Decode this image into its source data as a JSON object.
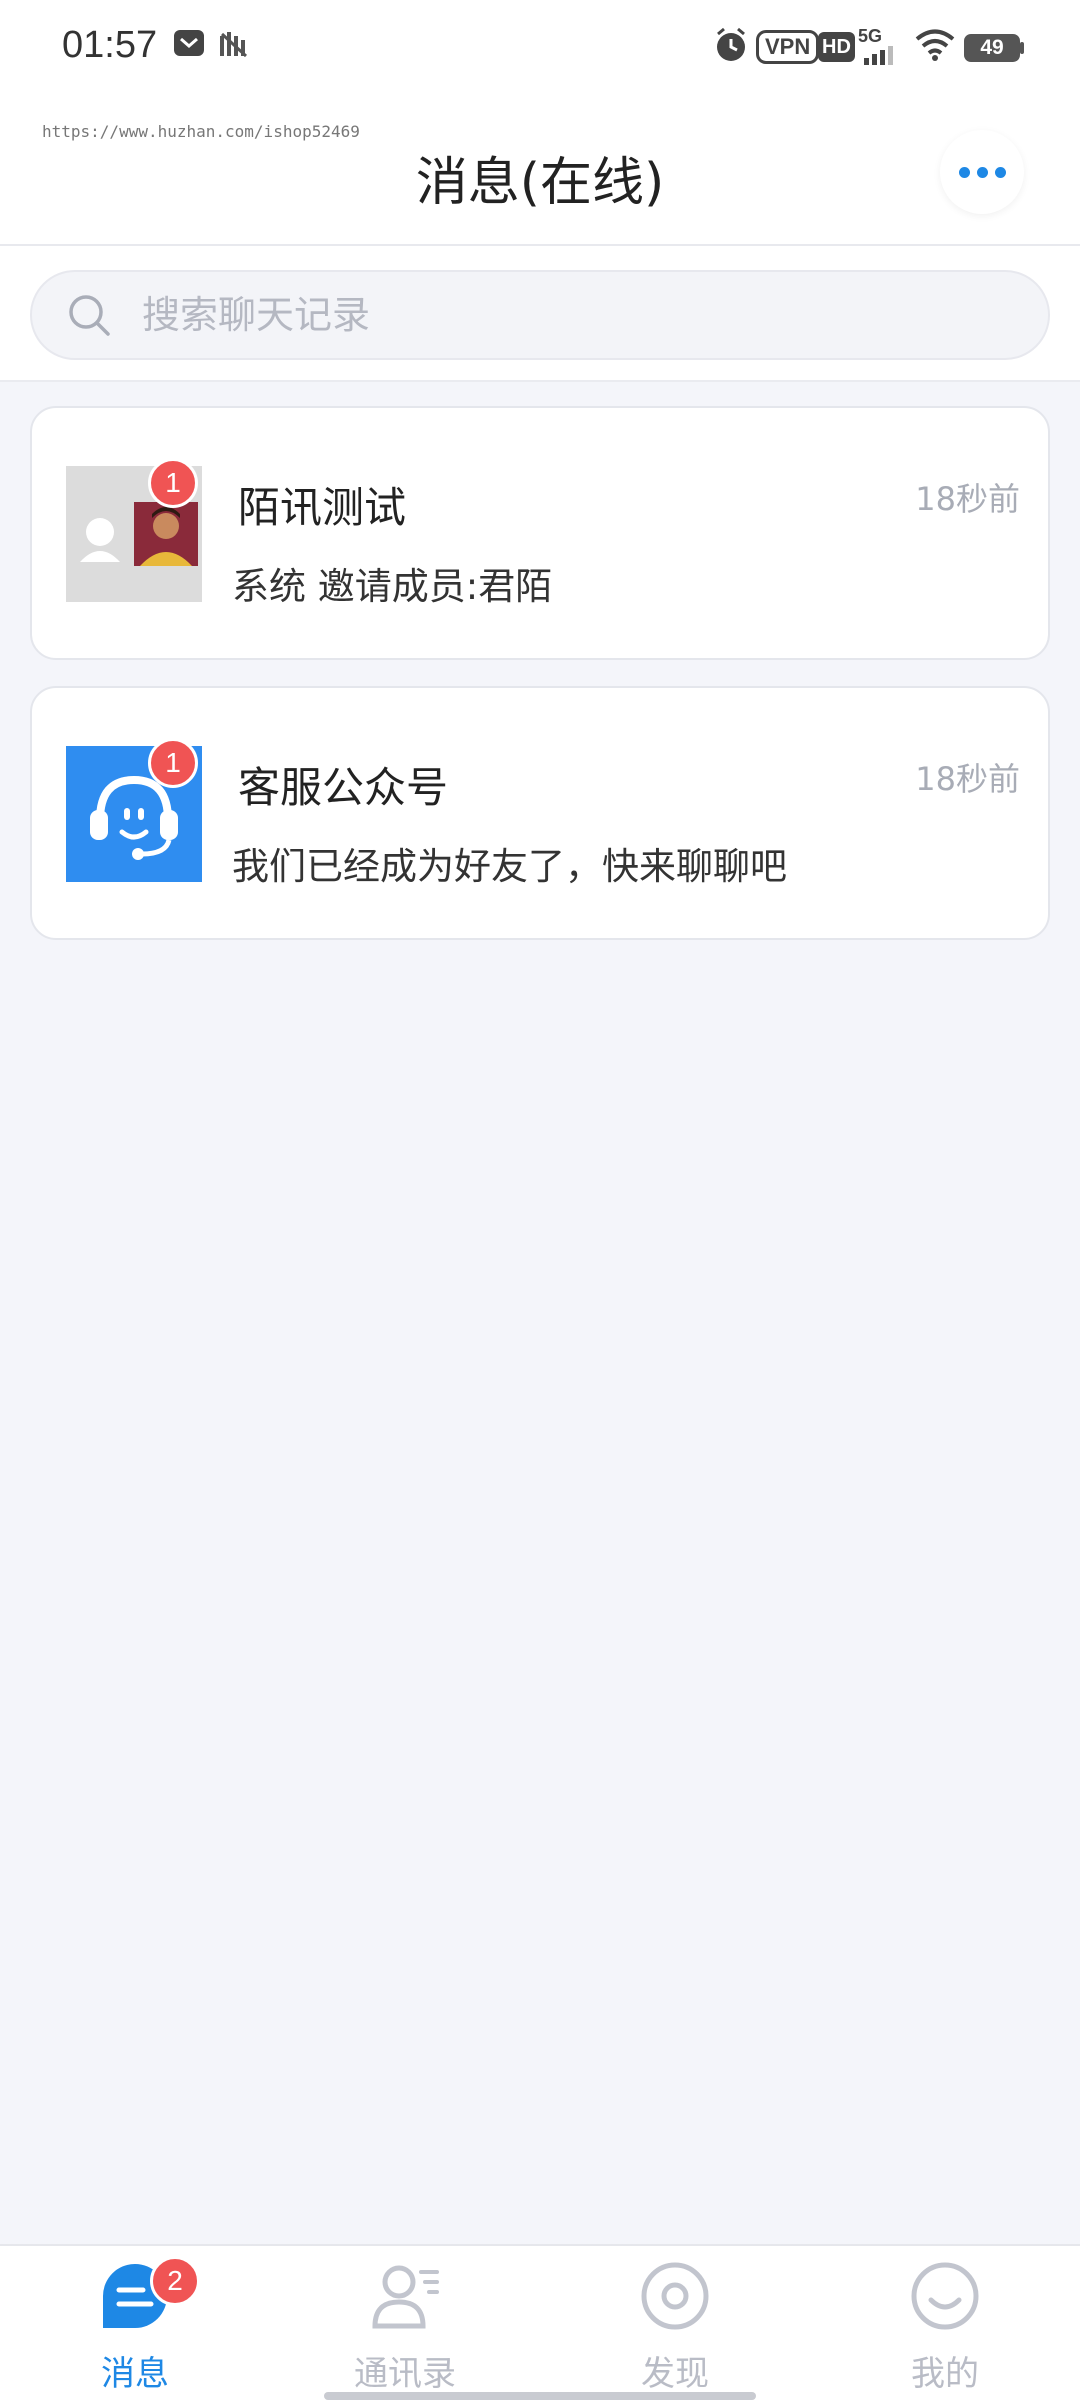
{
  "status_bar": {
    "time": "01:57",
    "vpn_label": "VPN",
    "hd_label": "HD",
    "network_label": "5G",
    "battery_level": "49",
    "icons": [
      "message-icon",
      "signal-app-icon",
      "alarm-icon",
      "vpn-icon",
      "hd-icon",
      "cellular-icon",
      "wifi-icon",
      "battery-icon"
    ]
  },
  "header": {
    "watermark": "https://www.huzhan.com/ishop52469",
    "title": "消息(在线)",
    "more_icon": "more-dots-icon"
  },
  "search": {
    "placeholder": "搜索聊天记录",
    "value": ""
  },
  "chats": [
    {
      "name": "陌讯测试",
      "preview": "系统 邀请成员:君陌",
      "time": "18秒前",
      "unread": "1",
      "avatar": "group-avatar"
    },
    {
      "name": "客服公众号",
      "preview": "我们已经成为好友了，快来聊聊吧",
      "time": "18秒前",
      "unread": "1",
      "avatar": "customer-service-avatar"
    }
  ],
  "tabbar": {
    "tabs": [
      {
        "label": "消息",
        "icon": "message-tab-icon",
        "active": true,
        "badge": "2"
      },
      {
        "label": "通讯录",
        "icon": "contacts-icon",
        "active": false
      },
      {
        "label": "发现",
        "icon": "discover-icon",
        "active": false
      },
      {
        "label": "我的",
        "icon": "profile-icon",
        "active": false
      }
    ]
  },
  "colors": {
    "accent": "#1e88e5",
    "badge": "#f05454",
    "background": "#f4f5fa",
    "muted_text": "#a8acb6"
  }
}
